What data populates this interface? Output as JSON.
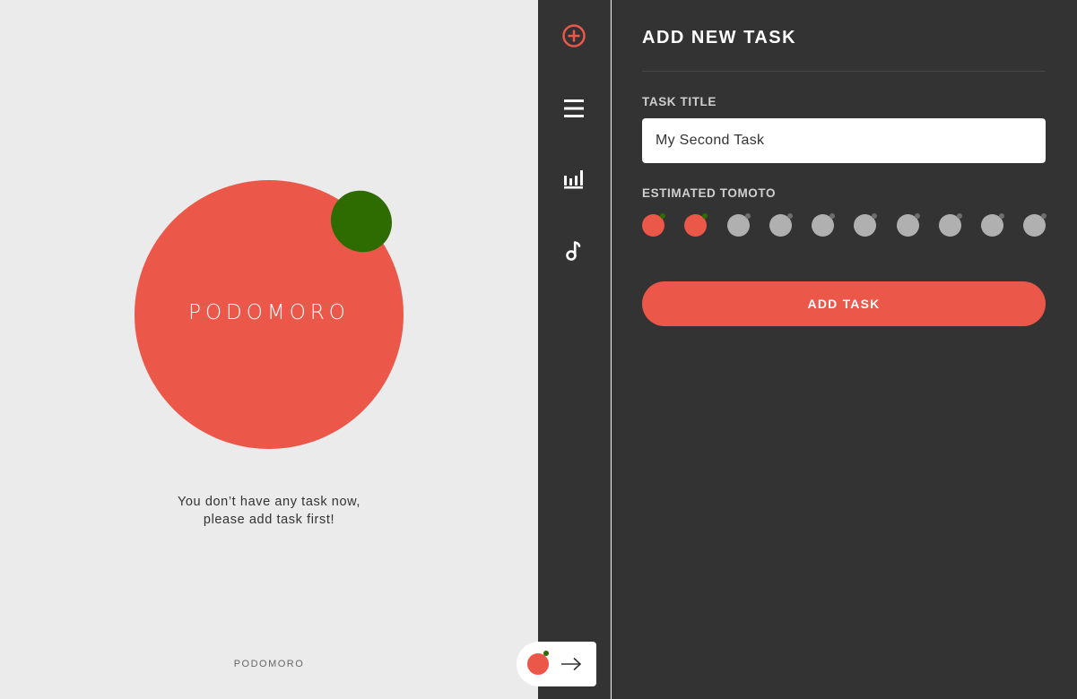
{
  "timer": {
    "title": "PODOMORO",
    "empty_line1": "You don’t have any task now,",
    "empty_line2": "please add task first!",
    "footer": "PODOMORO"
  },
  "nav": {
    "items": [
      {
        "name": "add-task",
        "icon": "plus-circle-icon",
        "active": true
      },
      {
        "name": "task-list",
        "icon": "menu-icon",
        "active": false
      },
      {
        "name": "analytics",
        "icon": "bar-chart-icon",
        "active": false
      },
      {
        "name": "ringtone",
        "icon": "music-note-icon",
        "active": false
      }
    ]
  },
  "panel": {
    "title": "ADD NEW TASK",
    "task_title_label": "TASK TITLE",
    "task_title_value": "My Second Task",
    "estimate_label": "ESTIMATED TOMOTO",
    "estimate_selected": 2,
    "estimate_total": 10,
    "submit_label": "ADD TASK"
  },
  "colors": {
    "accent": "#eb5749",
    "leaf": "#2e6b00",
    "dark": "#333333",
    "light": "#ebebeb",
    "inactive": "#b0b0b0"
  }
}
